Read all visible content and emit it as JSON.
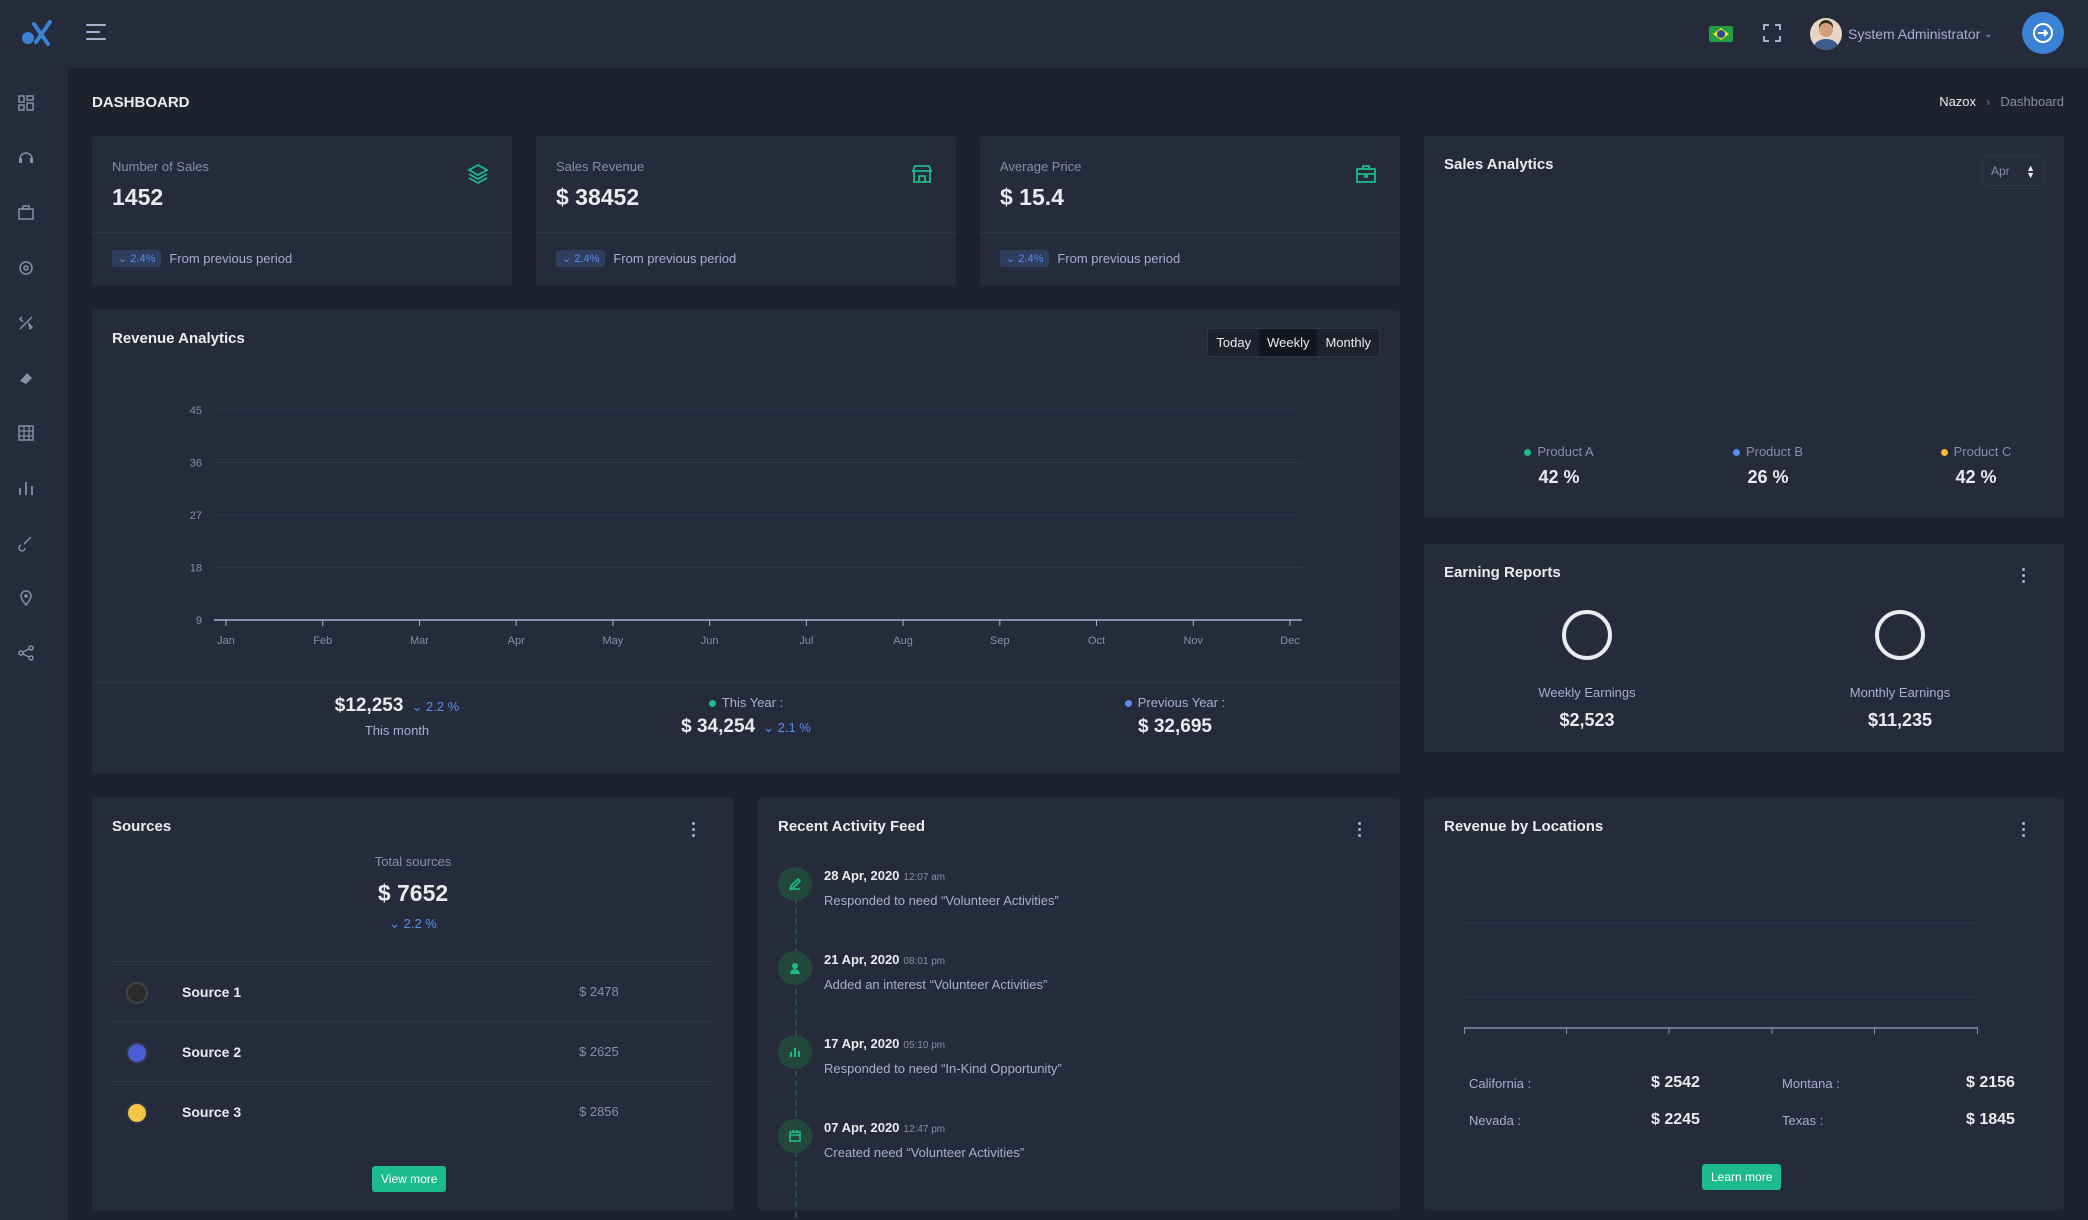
{
  "user": {
    "name": "System Administrator"
  },
  "page": {
    "title": "DASHBOARD",
    "breadcrumb": [
      "Nazox",
      "Dashboard"
    ]
  },
  "stats": [
    {
      "label": "Number of Sales",
      "value": "1452",
      "badge": "2.4%",
      "foot": "From previous period",
      "icon": "layers-icon"
    },
    {
      "label": "Sales Revenue",
      "value": "$ 38452",
      "badge": "2.4%",
      "foot": "From previous period",
      "icon": "store-icon"
    },
    {
      "label": "Average Price",
      "value": "$ 15.4",
      "badge": "2.4%",
      "foot": "From previous period",
      "icon": "briefcase-icon"
    }
  ],
  "revenue": {
    "title": "Revenue Analytics",
    "ranges": [
      "Today",
      "Weekly",
      "Monthly"
    ],
    "active_range": "Weekly",
    "month": {
      "value": "$12,253",
      "pct": "2.2 %",
      "label": "This month"
    },
    "this_year": {
      "label": "This Year :",
      "value": "$ 34,254",
      "pct": "2.1 %"
    },
    "prev_year": {
      "label": "Previous Year :",
      "value": "$ 32,695"
    }
  },
  "chart_data": {
    "type": "line",
    "categories": [
      "Jan",
      "Feb",
      "Mar",
      "Apr",
      "May",
      "Jun",
      "Jul",
      "Aug",
      "Sep",
      "Oct",
      "Nov",
      "Dec"
    ],
    "series": [],
    "title": "Revenue Analytics",
    "xlabel": "",
    "ylabel": "",
    "yticks": [
      9,
      18,
      27,
      36,
      45
    ],
    "ylim": [
      9,
      45
    ],
    "grid": true
  },
  "sales_analytics": {
    "title": "Sales Analytics",
    "month": "Apr",
    "products": [
      {
        "name": "Product A",
        "value": "42 %",
        "color": "#1cbb8c"
      },
      {
        "name": "Product B",
        "value": "26 %",
        "color": "#5b8def"
      },
      {
        "name": "Product C",
        "value": "42 %",
        "color": "#fcb92c"
      }
    ]
  },
  "earnings": {
    "title": "Earning Reports",
    "weekly": {
      "label": "Weekly Earnings",
      "value": "$2,523"
    },
    "monthly": {
      "label": "Monthly Earnings",
      "value": "$11,235"
    }
  },
  "sources": {
    "title": "Sources",
    "total_label": "Total sources",
    "total": "$ 7652",
    "pct": "2.2 %",
    "items": [
      {
        "name": "Source 1",
        "amount": "$ 2478"
      },
      {
        "name": "Source 2",
        "amount": "$ 2625"
      },
      {
        "name": "Source 3",
        "amount": "$ 2856"
      }
    ],
    "button": "View more"
  },
  "activity": {
    "title": "Recent Activity Feed",
    "items": [
      {
        "date": "28 Apr, 2020",
        "time": "12:07 am",
        "text": "Responded to need “Volunteer Activities”",
        "icon": "pencil-icon"
      },
      {
        "date": "21 Apr, 2020",
        "time": "08:01 pm",
        "text": "Added an interest “Volunteer Activities”",
        "icon": "user-icon"
      },
      {
        "date": "17 Apr, 2020",
        "time": "05:10 pm",
        "text": "Responded to need “In-Kind Opportunity”",
        "icon": "bar-chart-icon"
      },
      {
        "date": "07 Apr, 2020",
        "time": "12:47 pm",
        "text": "Created need “Volunteer Activities”",
        "icon": "calendar-icon"
      }
    ]
  },
  "locations": {
    "title": "Revenue by Locations",
    "items": [
      {
        "name": "California :",
        "value": "$ 2542"
      },
      {
        "name": "Montana :",
        "value": "$ 2156"
      },
      {
        "name": "Nevada :",
        "value": "$ 2245"
      },
      {
        "name": "Texas :",
        "value": "$ 1845"
      }
    ],
    "button": "Learn more"
  },
  "colors": {
    "accent": "#1cbb8c",
    "primary": "#5b8def",
    "warning": "#fcb92c",
    "card": "#252b3b",
    "background": "#1d222e"
  }
}
